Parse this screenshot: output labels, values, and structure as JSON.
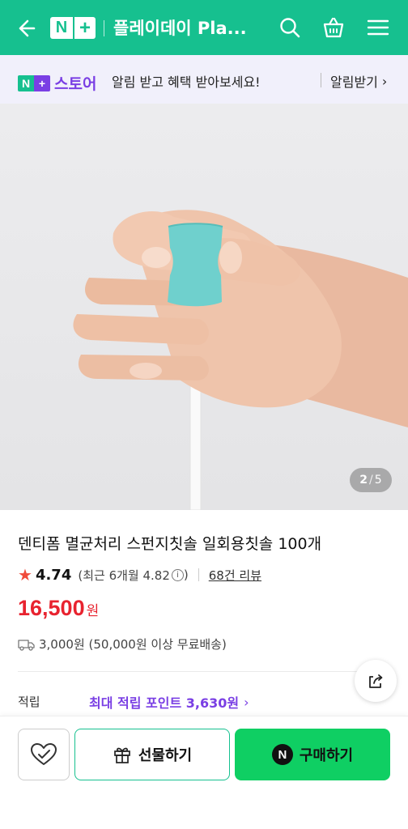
{
  "header": {
    "logo_n": "N",
    "logo_plus": "+",
    "store_title": "플레이데이 Pla...",
    "icons": [
      "back-arrow-icon",
      "search-icon",
      "shopping-bag-icon",
      "menu-icon"
    ],
    "background": "#16c08f"
  },
  "notice": {
    "logo_n": "N",
    "logo_plus": "+",
    "logo_text": "스토어",
    "message": "알림 받고 혜택 받아보세요!",
    "action": "알림받기",
    "chevron": "›"
  },
  "gallery": {
    "current": "2",
    "separator": "/",
    "total": "5"
  },
  "product": {
    "name": "덴티폼 멸균처리 스펀지칫솔 일회용칫솔 100개",
    "rating_star": "★",
    "rating": "4.74",
    "recent_rating": "(최근 6개월 4.82",
    "info_glyph": "i",
    "recent_close": ")",
    "review_count": "68건 리뷰",
    "price": "16,500",
    "price_unit": "원",
    "shipping": "3,000원 (50,000원 이상 무료배송)"
  },
  "points": {
    "label": "적립",
    "value": "최대 적립 포인트 3,630원",
    "chevron": "›"
  },
  "bottom_bar": {
    "gift_label": "선물하기",
    "buy_badge": "N",
    "buy_label": "구매하기"
  },
  "colors": {
    "brand_green": "#16c08f",
    "store_purple": "#7a3fe4",
    "price_red": "#e8232f",
    "buy_green": "#0fcf63"
  }
}
